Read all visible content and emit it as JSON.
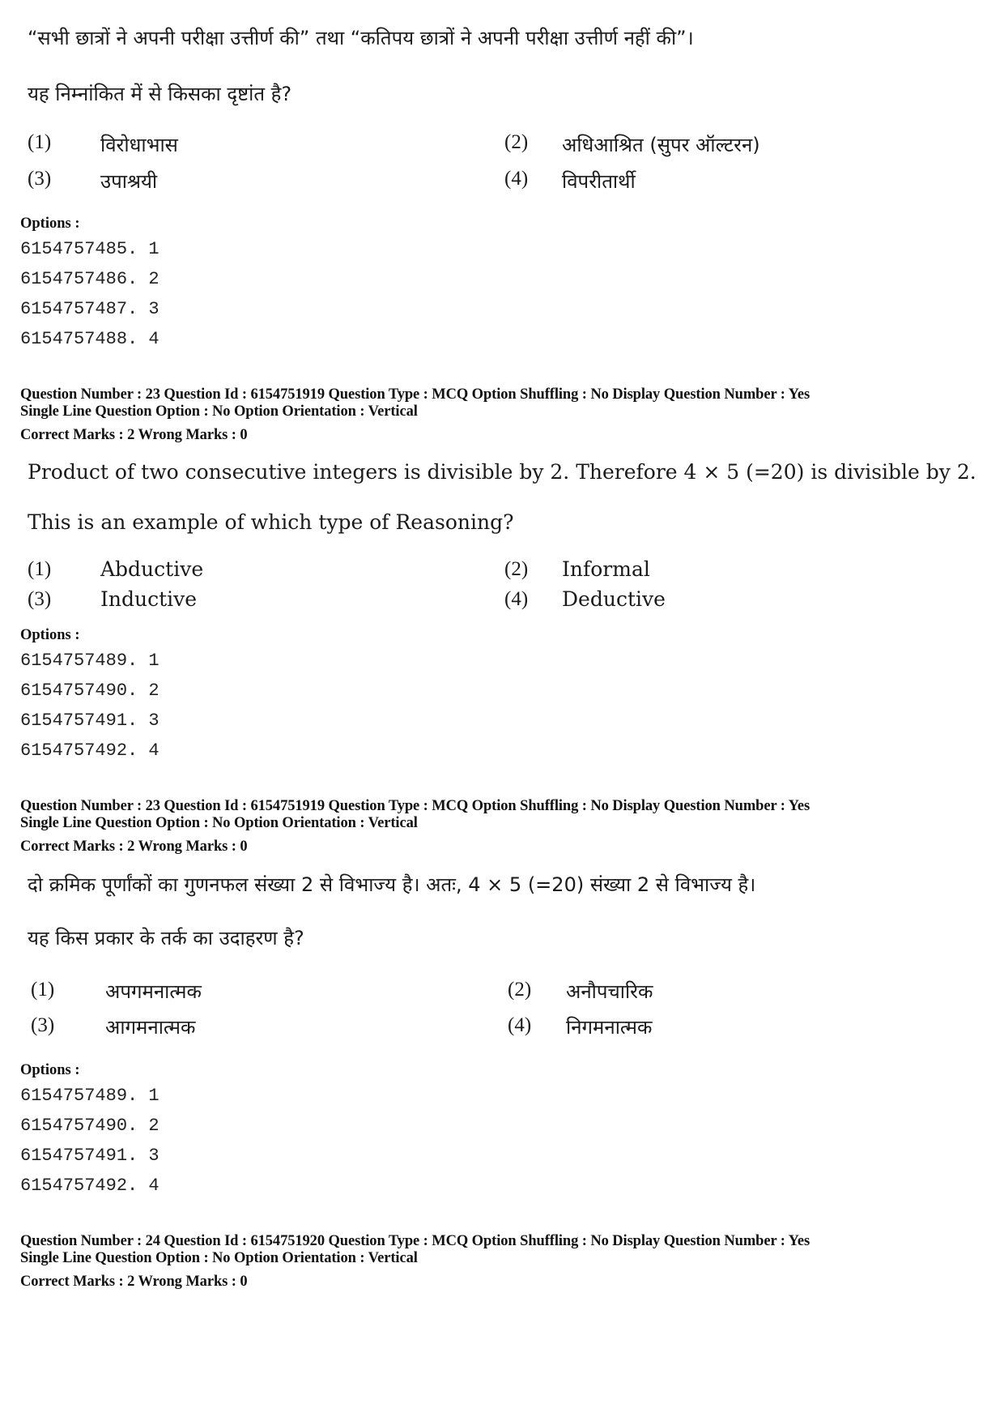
{
  "blocks": [
    {
      "question_text": [
        "“सभी छात्रों ने अपनी परीक्षा उत्तीर्ण की” तथा “कतिपय छात्रों ने अपनी परीक्षा उत्तीर्ण नहीं की”।",
        "यह निम्नांकित में से किसका दृष्टांत है?"
      ],
      "choices": [
        {
          "num": "(1)",
          "text": "विरोधाभास"
        },
        {
          "num": "(2)",
          "text": "अधिआश्रित (सुपर ऑल्टरन)"
        },
        {
          "num": "(3)",
          "text": "उपाश्रयी"
        },
        {
          "num": "(4)",
          "text": "विपरीतार्थी"
        }
      ],
      "options_label": "Options :",
      "option_ids": [
        "6154757485. 1",
        "6154757486. 2",
        "6154757487. 3",
        "6154757488. 4"
      ]
    },
    {
      "meta_line1": "Question Number : 23  Question Id : 6154751919  Question Type : MCQ  Option Shuffling : No  Display Question Number : Yes",
      "meta_line2": "Single Line Question Option : No  Option Orientation : Vertical",
      "marks": "Correct Marks : 2  Wrong Marks : 0",
      "question_text": [
        "Product of two consecutive integers is divisible by 2. Therefore 4 × 5 (=20) is divisible by 2.",
        "This is an example of which type of Reasoning?"
      ],
      "choices": [
        {
          "num": "(1)",
          "text": "Abductive"
        },
        {
          "num": "(2)",
          "text": "Informal"
        },
        {
          "num": "(3)",
          "text": "Inductive"
        },
        {
          "num": "(4)",
          "text": "Deductive"
        }
      ],
      "options_label": "Options :",
      "option_ids": [
        "6154757489. 1",
        "6154757490. 2",
        "6154757491. 3",
        "6154757492. 4"
      ]
    },
    {
      "meta_line1": "Question Number : 23  Question Id : 6154751919  Question Type : MCQ  Option Shuffling : No  Display Question Number : Yes",
      "meta_line2": "Single Line Question Option : No  Option Orientation : Vertical",
      "marks": "Correct Marks : 2  Wrong Marks : 0",
      "question_text": [
        "दो क्रमिक पूर्णांकों का गुणनफल संख्या 2 से विभाज्य है। अतः, 4 × 5 (=20) संख्या 2 से विभाज्य है।",
        "यह किस प्रकार के तर्क का उदाहरण है?"
      ],
      "choices": [
        {
          "num": "(1)",
          "text": "अपगमनात्मक"
        },
        {
          "num": "(2)",
          "text": "अनौपचारिक"
        },
        {
          "num": "(3)",
          "text": "आगमनात्मक"
        },
        {
          "num": "(4)",
          "text": "निगमनात्मक"
        }
      ],
      "options_label": "Options :",
      "option_ids": [
        "6154757489. 1",
        "6154757490. 2",
        "6154757491. 3",
        "6154757492. 4"
      ]
    },
    {
      "meta_line1": "Question Number : 24  Question Id : 6154751920  Question Type : MCQ  Option Shuffling : No  Display Question Number : Yes",
      "meta_line2": "Single Line Question Option : No  Option Orientation : Vertical",
      "marks": "Correct Marks : 2  Wrong Marks : 0"
    }
  ]
}
